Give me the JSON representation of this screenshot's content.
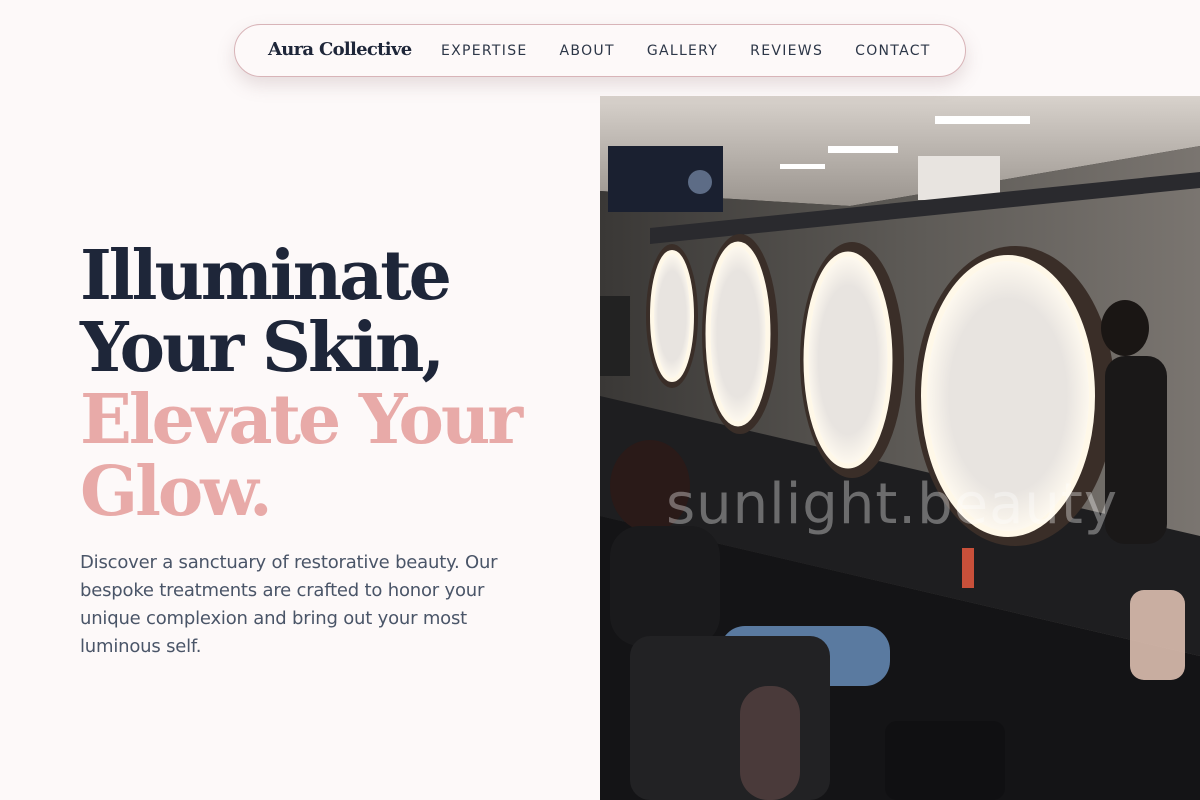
{
  "nav": {
    "brand": "Aura Collective",
    "links": [
      "EXPERTISE",
      "ABOUT",
      "GALLERY",
      "REVIEWS",
      "CONTACT"
    ]
  },
  "hero": {
    "title_line1": "Illuminate",
    "title_line2": "Your Skin,",
    "accent_line1": "Elevate Your",
    "accent_line2": "Glow.",
    "description": "Discover a sanctuary of restorative beauty. Our bespoke treatments are crafted to honor your unique complexion and bring out your most luminous self."
  },
  "image": {
    "watermark": "sunlight.beauty",
    "subject": "salon interior with illuminated round mirrors"
  },
  "colors": {
    "background": "#fdf9f9",
    "navy": "#1e2639",
    "accent_pink": "#e8aaa8",
    "body_text": "#4a5568",
    "nav_border": "#d8b4b8"
  }
}
